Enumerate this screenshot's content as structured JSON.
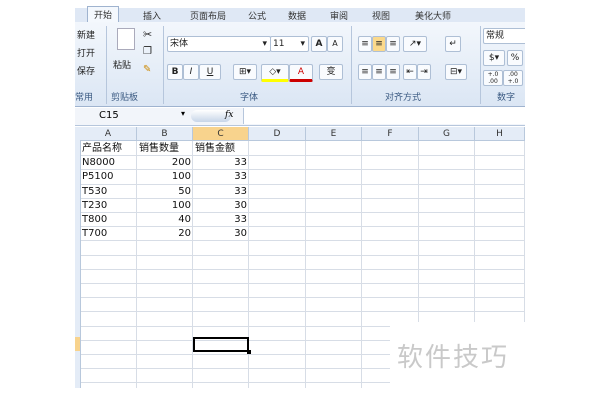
{
  "ribbon": {
    "tabs": [
      "开始",
      "插入",
      "页面布局",
      "公式",
      "数据",
      "审阅",
      "视图",
      "美化大师"
    ],
    "quick": [
      "新建",
      "打开",
      "保存"
    ],
    "quick_group": "常用",
    "clipboard": {
      "paste": "粘贴",
      "group": "剪贴板"
    },
    "font": {
      "name": "宋体",
      "size": "11",
      "bold": "B",
      "italic": "I",
      "underline": "U",
      "grow": "A",
      "shrink": "A",
      "color": "A",
      "phonetic": "变",
      "group": "字体"
    },
    "align": {
      "group": "对齐方式"
    },
    "number": {
      "format": "常规",
      "percent": "%",
      "inc": "+.0 .00",
      "dec": ".00 +.0",
      "group": "数字"
    }
  },
  "formula_bar": {
    "name_box": "C15",
    "fx": "fx",
    "value": ""
  },
  "sheet": {
    "columns": [
      "A",
      "B",
      "C",
      "D",
      "E",
      "F",
      "G",
      "H"
    ],
    "selected_column": "C",
    "selected_cell": "C15",
    "headers": [
      "产品名称",
      "销售数量",
      "销售金额"
    ],
    "rows": [
      [
        "N8000",
        "200",
        "33"
      ],
      [
        "P5100",
        "100",
        "33"
      ],
      [
        "T530",
        "50",
        "33"
      ],
      [
        "T230",
        "100",
        "30"
      ],
      [
        "T800",
        "40",
        "33"
      ],
      [
        "T700",
        "20",
        "30"
      ]
    ]
  },
  "watermark": "软件技巧"
}
